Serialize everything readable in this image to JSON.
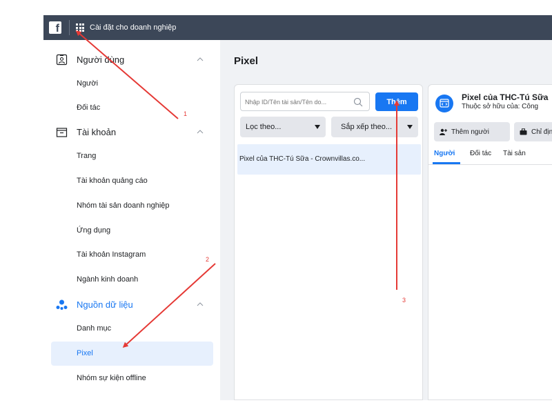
{
  "topbar": {
    "logo_letter": "f",
    "title": "Cài đặt cho doanh nghiệp",
    "bg_color": "#3c4758"
  },
  "sidebar": {
    "sections": [
      {
        "label": "Người dùng",
        "icon": "user-id-icon",
        "items": [
          "Người",
          "Đối tác"
        ]
      },
      {
        "label": "Tài khoản",
        "icon": "folder-icon",
        "items": [
          "Trang",
          "Tài khoản quảng cáo",
          "Nhóm tài sản doanh nghiệp",
          "Ứng dụng",
          "Tài khoản Instagram",
          "Ngành kinh doanh"
        ]
      },
      {
        "label": "Nguồn dữ liệu",
        "icon": "data-sources-icon",
        "items": [
          "Danh mục",
          "Pixel",
          "Nhóm sự kiện offline"
        ],
        "active_item": "Pixel"
      }
    ]
  },
  "main": {
    "title": "Pixel",
    "search": {
      "placeholder": "Nhập ID/Tên tài sản/Tên do...",
      "value": ""
    },
    "add_button": "Thêm",
    "filter_label": "Lọc theo...",
    "sort_label": "Sắp xếp theo...",
    "list_items": [
      "Pixel của THC-Tú Sữa - Crownvillas.co..."
    ]
  },
  "detail": {
    "name": "Pixel của THC-Tú Sữa",
    "owner": "Thuộc sở hữu của: Công",
    "add_people": "Thêm người",
    "assign_partner": "Chỉ định",
    "tabs": [
      "Người",
      "Đối tác",
      "Tài sản"
    ]
  },
  "annotations": {
    "steps": [
      "1",
      "2",
      "3"
    ],
    "color": "#e53935"
  },
  "colors": {
    "accent": "#1877f2",
    "active_bg": "#e7f0fd",
    "content_bg": "#f0f2f5"
  }
}
